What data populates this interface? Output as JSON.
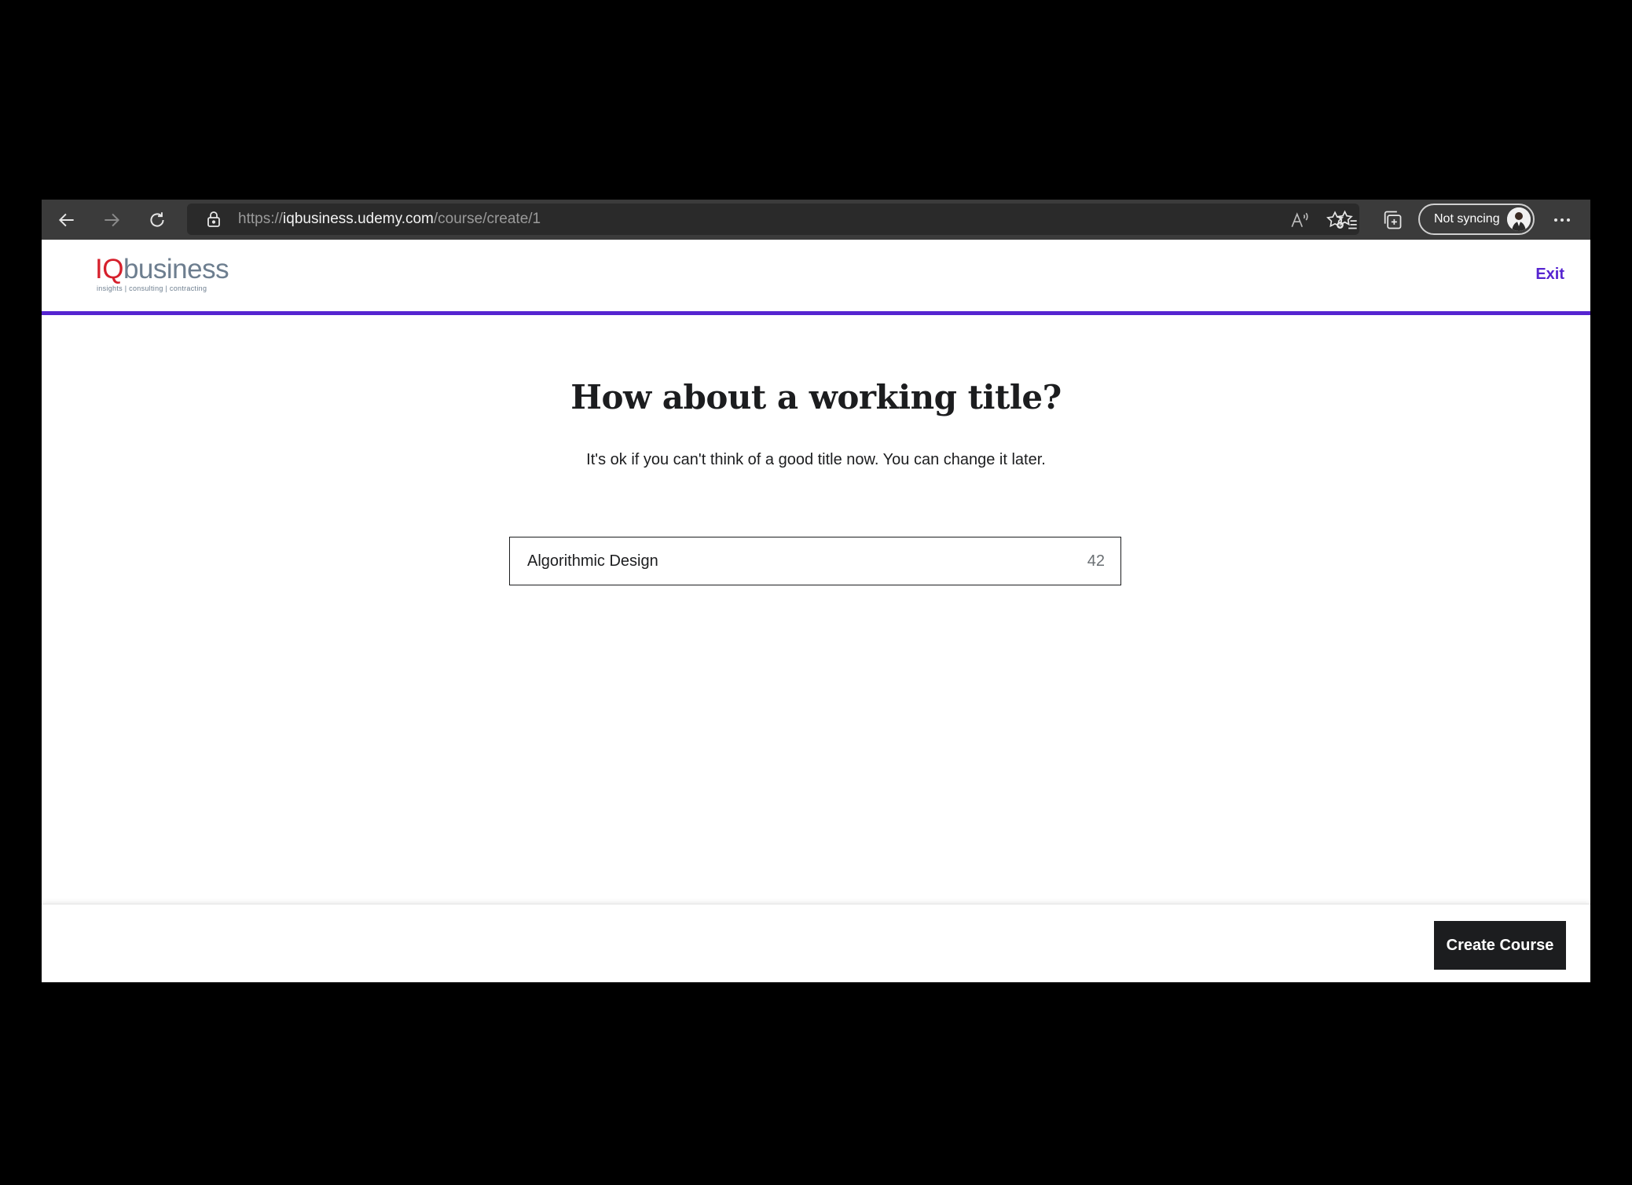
{
  "browser": {
    "url_prefix": "https://",
    "url_host": "iqbusiness.udemy.com",
    "url_path": "/course/create/1",
    "profile_label": "Not syncing"
  },
  "header": {
    "logo_iq": "IQ",
    "logo_business": "business",
    "logo_tagline": "insights | consulting | contracting",
    "exit_label": "Exit"
  },
  "main": {
    "title": "How about a working title?",
    "subtitle": "It's ok if you can't think of a good title now. You can change it later.",
    "title_input_value": "Algorithmic Design",
    "char_counter": "42"
  },
  "footer": {
    "create_button_label": "Create Course"
  },
  "colors": {
    "accent": "#5624d0",
    "text": "#1c1d1f",
    "chrome": "#3b3b3b",
    "logo_red": "#d6202c"
  }
}
